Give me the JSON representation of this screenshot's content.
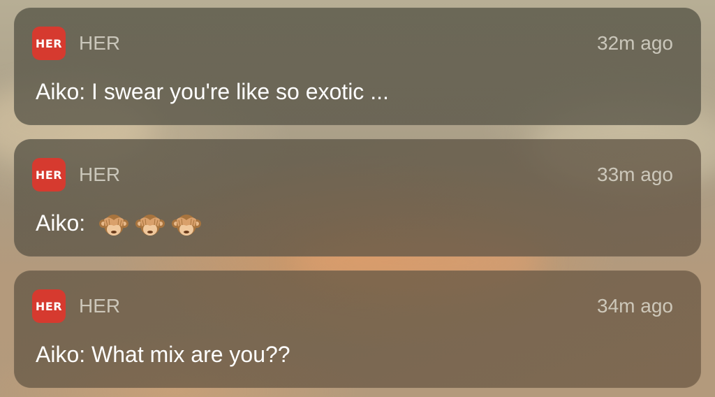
{
  "notifications": [
    {
      "app_icon_text": "HER",
      "app_name": "HER",
      "time": "32m ago",
      "sender": "Aiko:",
      "body": "I swear you're like so exotic ..."
    },
    {
      "app_icon_text": "HER",
      "app_name": "HER",
      "time": "33m ago",
      "sender": "Aiko:",
      "body": "",
      "emojis": [
        "see-no-evil-monkey-icon",
        "see-no-evil-monkey-icon",
        "see-no-evil-monkey-icon"
      ]
    },
    {
      "app_icon_text": "HER",
      "app_name": "HER",
      "time": "34m ago",
      "sender": "Aiko:",
      "body": "What mix are you??"
    }
  ],
  "colors": {
    "app_icon_bg": "#d63a2f",
    "card_bg": "#5a5646",
    "secondary_text": "#e4e2d6",
    "primary_text": "#ffffff"
  }
}
